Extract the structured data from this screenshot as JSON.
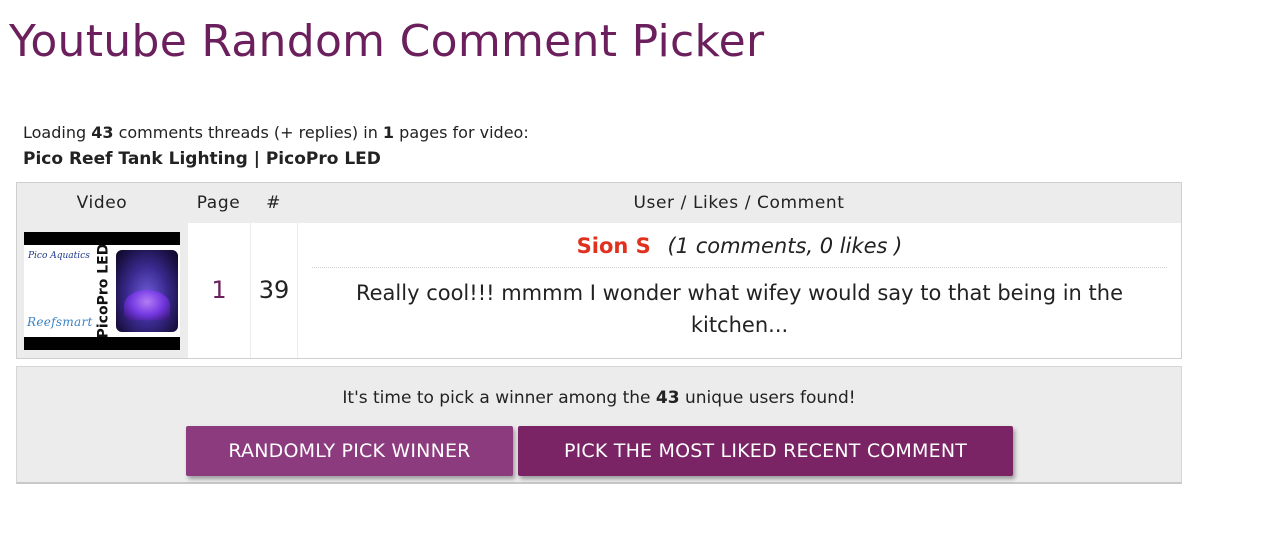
{
  "page": {
    "title": "Youtube Random Comment Picker"
  },
  "loading": {
    "prefix": "Loading",
    "thread_count": "43",
    "middle": "comments threads (+ replies) in",
    "page_count": "1",
    "suffix": "pages for video:",
    "video_title": "Pico Reef Tank Lighting | PicoPro LED"
  },
  "table": {
    "headers": {
      "video": "Video",
      "page": "Page",
      "index": "#",
      "comment": "User / Likes / Comment"
    },
    "row": {
      "thumbnail": {
        "vertical_text": "PicoPro LED",
        "brand_text": "Reefsmart",
        "logo_text": "Pico Aquatics"
      },
      "page": "1",
      "index": "39",
      "user_name": "Sion S",
      "user_stats": "(1 comments, 0 likes )",
      "comment": "Really cool!!! mmmm I wonder what wifey would say to that being in the kitchen..."
    }
  },
  "winner": {
    "text_prefix": "It's time to pick a winner among the",
    "unique_users": "43",
    "text_suffix": "unique users found!",
    "random_button": "RANDOMLY PICK WINNER",
    "liked_button": "PICK THE MOST LIKED RECENT COMMENT"
  },
  "colors": {
    "title": "#6b1f5c",
    "user_name": "#e0311f",
    "button_random": "#8c3b7e",
    "button_liked": "#7a2466",
    "panel_bg": "#ececec"
  }
}
